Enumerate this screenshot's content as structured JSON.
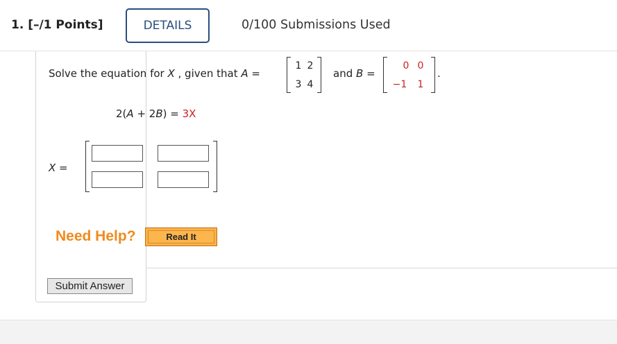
{
  "header": {
    "question_title": "1.  [–/1 Points]",
    "details_label": "DETAILS",
    "submissions": "0/100 Submissions Used"
  },
  "question": {
    "prompt_prefix": "Solve the equation for ",
    "prompt_var": "X",
    "prompt_mid": " , given that ",
    "prompt_var_a": "A",
    "prompt_eq": " = ",
    "matrix_a": [
      [
        "1",
        "2"
      ],
      [
        "3",
        "4"
      ]
    ],
    "and_text": "and ",
    "var_b": "B",
    "eq_b": " = ",
    "matrix_b": [
      [
        "0",
        "0"
      ],
      [
        "−1",
        "1"
      ]
    ],
    "period": ".",
    "equation_left": "2(",
    "equation_a": "A",
    "equation_plus": " + 2",
    "equation_b": "B",
    "equation_close": ") = ",
    "equation_right": "3X",
    "answer_label_var": "X",
    "answer_label_eq": " ="
  },
  "help": {
    "need_help": "Need Help?",
    "read_it": "Read It"
  },
  "actions": {
    "submit_label": "Submit Answer"
  }
}
